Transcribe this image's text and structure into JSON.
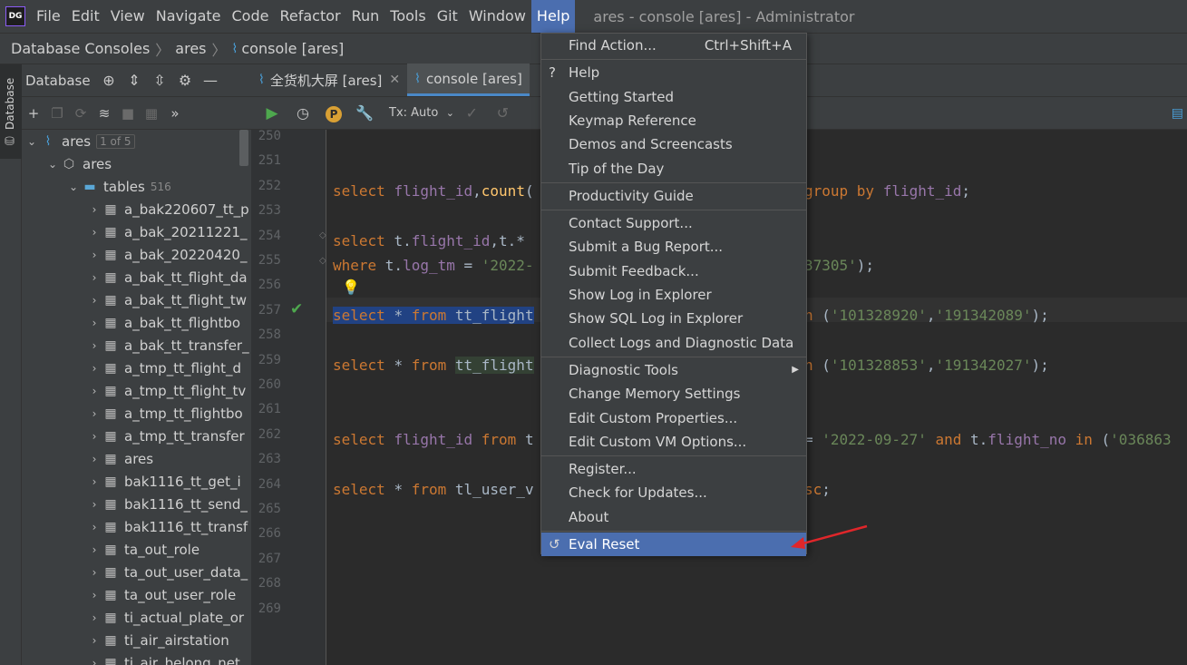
{
  "app": {
    "logo": "DG",
    "window_title": "ares - console [ares] - Administrator"
  },
  "menubar": {
    "items": [
      "File",
      "Edit",
      "View",
      "Navigate",
      "Code",
      "Refactor",
      "Run",
      "Tools",
      "Git",
      "Window",
      "Help"
    ],
    "active": "Help"
  },
  "breadcrumb": {
    "items": [
      "Database Consoles",
      "ares",
      "console [ares]"
    ]
  },
  "tool_strip": {
    "label": "Database"
  },
  "db_panel": {
    "title": "Database",
    "tree": [
      {
        "label": "ares",
        "badge": "1 of 5",
        "type": "datasource",
        "level": 0,
        "expanded": true
      },
      {
        "label": "ares",
        "type": "schema",
        "level": 1,
        "expanded": true
      },
      {
        "label": "tables",
        "count": "516",
        "type": "folder",
        "level": 2,
        "expanded": true
      },
      {
        "label": "a_bak220607_tt_p",
        "type": "table",
        "level": 3
      },
      {
        "label": "a_bak_20211221_",
        "type": "table",
        "level": 3
      },
      {
        "label": "a_bak_20220420_",
        "type": "table",
        "level": 3
      },
      {
        "label": "a_bak_tt_flight_da",
        "type": "table",
        "level": 3
      },
      {
        "label": "a_bak_tt_flight_tw",
        "type": "table",
        "level": 3
      },
      {
        "label": "a_bak_tt_flightbo",
        "type": "table",
        "level": 3
      },
      {
        "label": "a_bak_tt_transfer_",
        "type": "table",
        "level": 3
      },
      {
        "label": "a_tmp_tt_flight_d",
        "type": "table",
        "level": 3
      },
      {
        "label": "a_tmp_tt_flight_tv",
        "type": "table",
        "level": 3
      },
      {
        "label": "a_tmp_tt_flightbo",
        "type": "table",
        "level": 3
      },
      {
        "label": "a_tmp_tt_transfer",
        "type": "table",
        "level": 3
      },
      {
        "label": "ares",
        "type": "table",
        "level": 3
      },
      {
        "label": "bak1116_tt_get_i",
        "type": "table",
        "level": 3
      },
      {
        "label": "bak1116_tt_send_",
        "type": "table",
        "level": 3
      },
      {
        "label": "bak1116_tt_transf",
        "type": "table",
        "level": 3
      },
      {
        "label": "ta_out_role",
        "type": "table",
        "level": 3
      },
      {
        "label": "ta_out_user_data_",
        "type": "table",
        "level": 3
      },
      {
        "label": "ta_out_user_role",
        "type": "table",
        "level": 3
      },
      {
        "label": "ti_actual_plate_or",
        "type": "table",
        "level": 3
      },
      {
        "label": "ti_air_airstation",
        "type": "table",
        "level": 3
      },
      {
        "label": "ti_air_belong_net",
        "type": "table",
        "level": 3
      }
    ]
  },
  "editor": {
    "tabs": [
      {
        "label": "全货机大屏 [ares]",
        "active": false
      },
      {
        "label": "console [ares]",
        "active": true
      }
    ],
    "tx_mode": "Tx: Auto",
    "line_numbers": [
      "250",
      "251",
      "252",
      "253",
      "254",
      "255",
      "256",
      "257",
      "258",
      "259",
      "260",
      "261",
      "262",
      "263",
      "264",
      "265",
      "266",
      "267",
      "268",
      "269"
    ],
    "lines": {
      "l252": [
        [
          "kw",
          "select "
        ],
        [
          "id",
          "flight_id"
        ],
        [
          "plain",
          ","
        ],
        [
          "fn",
          "count"
        ],
        [
          "plain",
          "("
        ]
      ],
      "l252_tail": [
        [
          "kw",
          "group by "
        ],
        [
          "id",
          "flight_id"
        ],
        [
          "plain",
          ";"
        ]
      ],
      "l254": [
        [
          "kw",
          "select "
        ],
        [
          "plain",
          "t."
        ],
        [
          "id",
          "flight_id"
        ],
        [
          "plain",
          ",t.* "
        ]
      ],
      "l255": [
        [
          "kw",
          "where "
        ],
        [
          "plain",
          "t."
        ],
        [
          "id",
          "log_tm"
        ],
        [
          "plain",
          " = "
        ],
        [
          "str",
          "'2022-"
        ]
      ],
      "l255_tail": [
        [
          "str",
          "37305'"
        ],
        [
          "plain",
          ");"
        ]
      ],
      "l257": [
        [
          "kw",
          "select "
        ],
        [
          "plain",
          "* "
        ],
        [
          "kw",
          "from "
        ],
        [
          "plain",
          "tt_flight"
        ]
      ],
      "l257_tail": [
        [
          "kw",
          "n "
        ],
        [
          "plain",
          "("
        ],
        [
          "str",
          "'101328920'"
        ],
        [
          "plain",
          ","
        ],
        [
          "str",
          "'191342089'"
        ],
        [
          "plain",
          ");"
        ]
      ],
      "l259": [
        [
          "kw",
          "select "
        ],
        [
          "plain",
          "* "
        ],
        [
          "kw",
          "from "
        ],
        [
          "plain",
          "tt_flight"
        ]
      ],
      "l259_tail": [
        [
          "kw",
          "n "
        ],
        [
          "plain",
          "("
        ],
        [
          "str",
          "'101328853'"
        ],
        [
          "plain",
          ","
        ],
        [
          "str",
          "'191342027'"
        ],
        [
          "plain",
          ");"
        ]
      ],
      "l262": [
        [
          "kw",
          "select "
        ],
        [
          "id",
          "flight_id "
        ],
        [
          "kw",
          "from "
        ],
        [
          "plain",
          "t"
        ]
      ],
      "l262_tail": [
        [
          "plain",
          "= "
        ],
        [
          "str",
          "'2022-09-27'"
        ],
        [
          "kw",
          " and "
        ],
        [
          "plain",
          "t."
        ],
        [
          "id",
          "flight_no"
        ],
        [
          "kw",
          " in "
        ],
        [
          "plain",
          "("
        ],
        [
          "str",
          "'036863"
        ]
      ],
      "l264": [
        [
          "kw",
          "select "
        ],
        [
          "plain",
          "* "
        ],
        [
          "kw",
          "from "
        ],
        [
          "plain",
          "tl_user_v"
        ]
      ],
      "l264_tail": [
        [
          "kw",
          "sc"
        ],
        [
          "plain",
          ";"
        ]
      ]
    }
  },
  "help_menu": {
    "groups": [
      [
        {
          "label": "Find Action...",
          "shortcut": "Ctrl+Shift+A"
        }
      ],
      [
        {
          "label": "Help",
          "icon": "?"
        },
        {
          "label": "Getting Started"
        },
        {
          "label": "Keymap Reference"
        },
        {
          "label": "Demos and Screencasts"
        },
        {
          "label": "Tip of the Day"
        }
      ],
      [
        {
          "label": "Productivity Guide"
        }
      ],
      [
        {
          "label": "Contact Support..."
        },
        {
          "label": "Submit a Bug Report..."
        },
        {
          "label": "Submit Feedback..."
        },
        {
          "label": "Show Log in Explorer"
        },
        {
          "label": "Show SQL Log in Explorer"
        },
        {
          "label": "Collect Logs and Diagnostic Data"
        }
      ],
      [
        {
          "label": "Diagnostic Tools",
          "submenu": true
        },
        {
          "label": "Change Memory Settings"
        },
        {
          "label": "Edit Custom Properties..."
        },
        {
          "label": "Edit Custom VM Options..."
        }
      ],
      [
        {
          "label": "Register..."
        },
        {
          "label": "Check for Updates..."
        },
        {
          "label": "About"
        }
      ],
      [
        {
          "label": "Eval Reset",
          "icon": "↺",
          "selected": true
        }
      ]
    ]
  },
  "colors": {
    "accent": "#4b6eaf",
    "annotation": "#e0262a"
  }
}
